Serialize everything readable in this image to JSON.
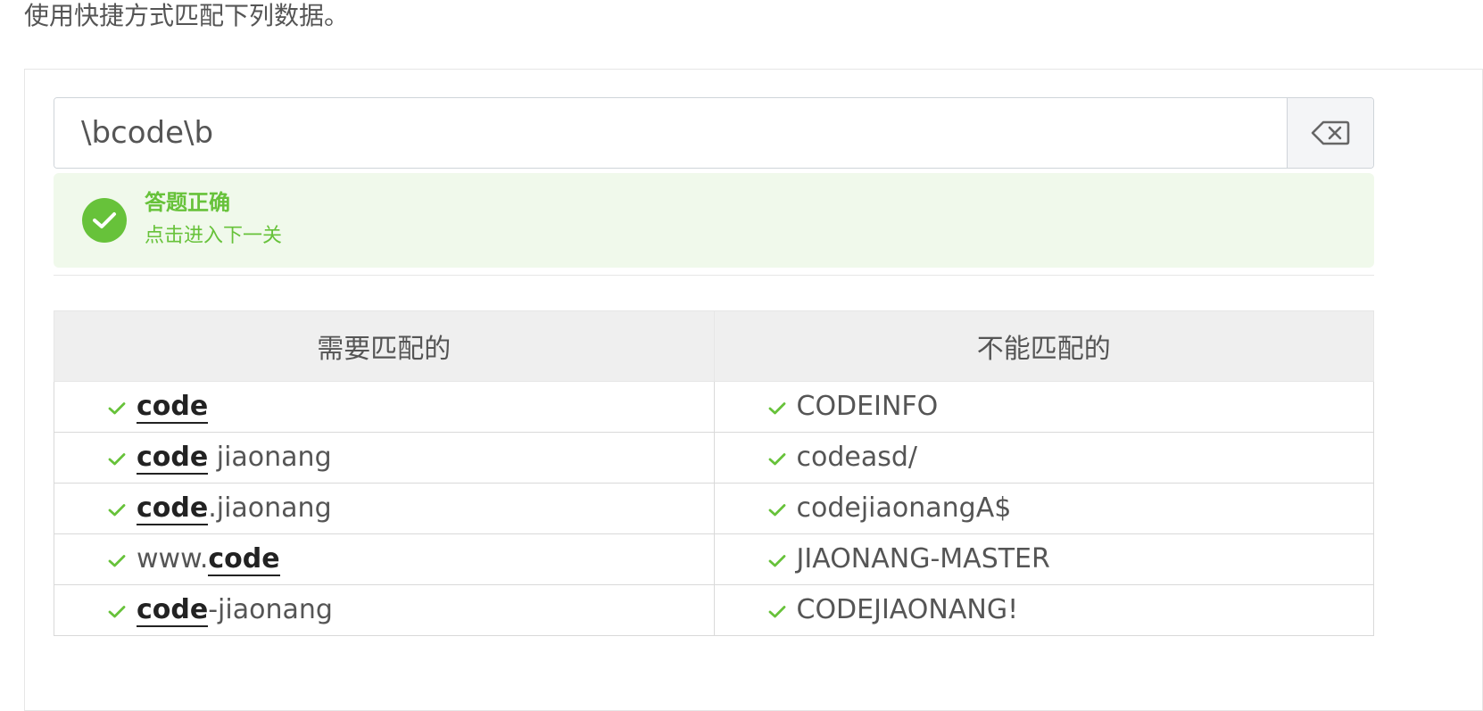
{
  "instruction": "使用快捷方式匹配下列数据。",
  "input": {
    "value": "\\bcode\\b"
  },
  "clear_icon": "backspace-clear-icon",
  "result": {
    "title": "答题正确",
    "description": "点击进入下一关",
    "icon": "check-circle-icon"
  },
  "table": {
    "headers": [
      "需要匹配的",
      "不能匹配的"
    ],
    "rows": [
      {
        "match": [
          {
            "t": "code",
            "m": true
          }
        ],
        "nomatch": "CODEINFO"
      },
      {
        "match": [
          {
            "t": "code",
            "m": true
          },
          {
            "t": " jiaonang",
            "m": false
          }
        ],
        "nomatch": "codeasd/"
      },
      {
        "match": [
          {
            "t": "code",
            "m": true
          },
          {
            "t": ".jiaonang",
            "m": false
          }
        ],
        "nomatch": "codejiaonangA$"
      },
      {
        "match": [
          {
            "t": "www.",
            "m": false
          },
          {
            "t": "code",
            "m": true
          }
        ],
        "nomatch": "JIAONANG-MASTER"
      },
      {
        "match": [
          {
            "t": "code",
            "m": true
          },
          {
            "t": "-jiaonang",
            "m": false
          }
        ],
        "nomatch": "CODEJIAONANG!"
      }
    ],
    "row_icon": "check-icon"
  },
  "colors": {
    "success": "#67c23a",
    "success_bg": "#f0f9eb",
    "header_bg": "#efefef"
  }
}
